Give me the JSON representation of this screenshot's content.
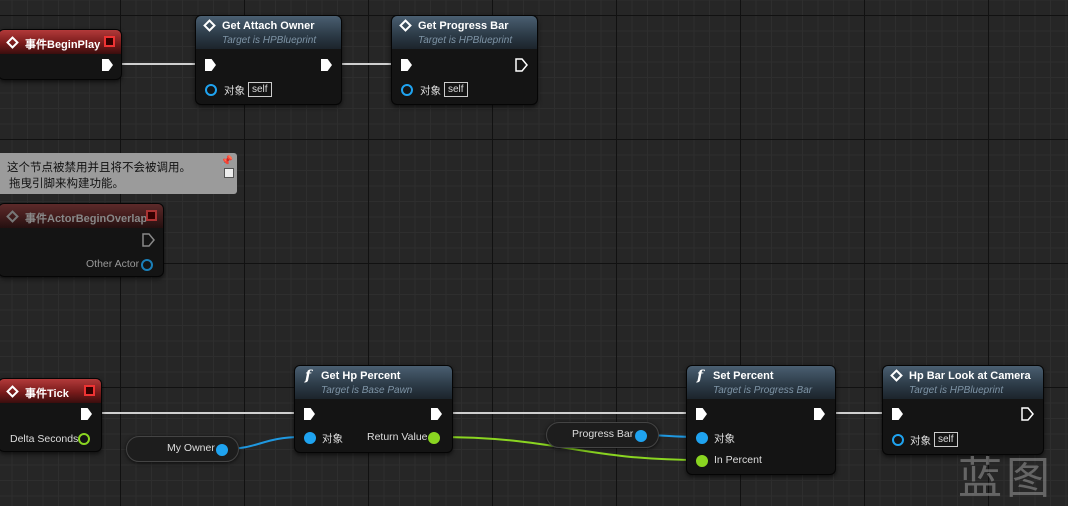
{
  "nodes": {
    "begin_play": {
      "title": "事件BeginPlay"
    },
    "get_attach_owner": {
      "title": "Get Attach Owner",
      "subtitle": "Target is HPBlueprint",
      "target_label": "对象",
      "target_value": "self"
    },
    "get_progress_bar": {
      "title": "Get Progress Bar",
      "subtitle": "Target is HPBlueprint",
      "target_label": "对象",
      "target_value": "self"
    },
    "actor_begin_overlap": {
      "title": "事件ActorBeginOverlap",
      "output_label": "Other Actor"
    },
    "event_tick": {
      "title": "事件Tick",
      "output_label": "Delta Seconds"
    },
    "get_hp_percent": {
      "title": "Get Hp Percent",
      "subtitle": "Target is Base Pawn",
      "target_label": "对象",
      "return_label": "Return Value"
    },
    "set_percent": {
      "title": "Set Percent",
      "subtitle": "Target is Progress Bar",
      "target_label": "对象",
      "in_label": "In Percent"
    },
    "hp_bar_look": {
      "title": "Hp Bar Look at Camera",
      "subtitle": "Target is HPBlueprint",
      "target_label": "对象",
      "target_value": "self"
    }
  },
  "variables": {
    "my_owner": "My Owner",
    "progress_bar": "Progress Bar"
  },
  "comment": {
    "line1": "这个节点被禁用并且将不会被调用。",
    "line2": "拖曳引脚来构建功能。"
  },
  "watermark": "蓝图",
  "colors": {
    "exec_wire": "#d8d8d8",
    "object_pin": "#1fa3f0",
    "float_pin": "#8ad521",
    "event_header": "#8a2020",
    "function_header": "#3a4b5a"
  }
}
